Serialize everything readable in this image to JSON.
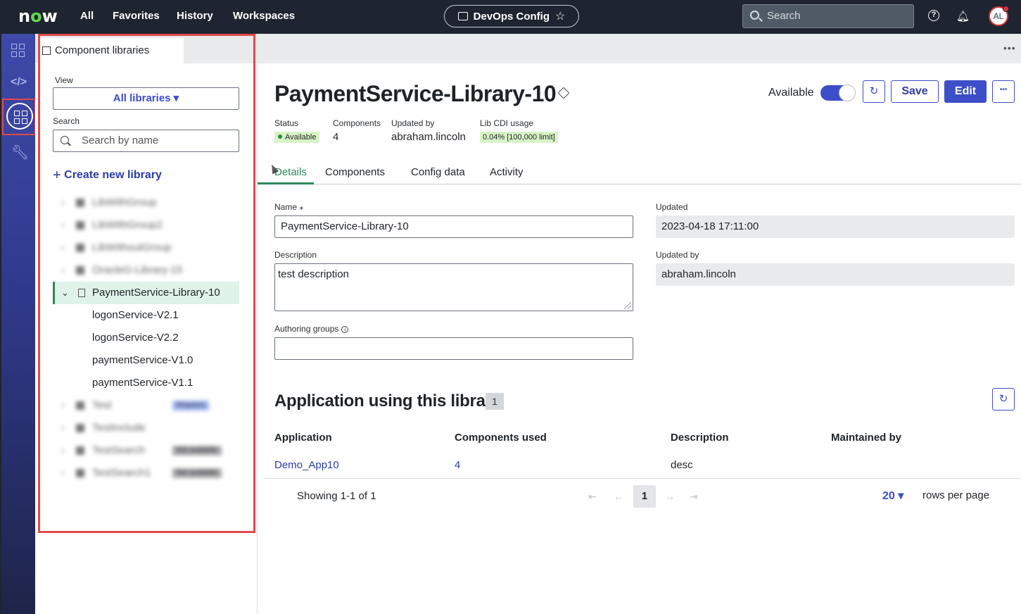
{
  "topbar": {
    "logo": "now",
    "nav": [
      "All",
      "Favorites",
      "History",
      "Workspaces"
    ],
    "workspace_pill": "DevOps Config",
    "search_placeholder": "Search",
    "avatar_initials": "AL"
  },
  "rail": {
    "icons": [
      "apps-grid-icon",
      "code-icon",
      "component-libraries-icon",
      "wrench-icon"
    ],
    "active": "component-libraries-icon"
  },
  "left_panel": {
    "tab_label": "Component libraries",
    "view_label": "View",
    "view_value": "All libraries",
    "search_label": "Search",
    "search_placeholder": "Search by name",
    "create_label": "Create new library",
    "tree_blurred": [
      {
        "label": "LibWithGroup"
      },
      {
        "label": "LibWithGroup2"
      },
      {
        "label": "LibWithoutGroup"
      },
      {
        "label": "OracleG-Library-15"
      }
    ],
    "selected": "PaymentService-Library-10",
    "children": [
      "logonService-V2.1",
      "logonService-V2.2",
      "paymentService-V1.0",
      "paymentService-V1.1"
    ],
    "tree_blurred_after": [
      {
        "label": "Test",
        "badge": "Requires"
      },
      {
        "label": "TestInclude",
        "badge": ""
      },
      {
        "label": "TestSearch",
        "badge": "Not available"
      },
      {
        "label": "TestSearch1",
        "badge": "Not available"
      }
    ]
  },
  "record": {
    "title": "PaymentService-Library-10",
    "status_label": "Status",
    "status_value": "Available",
    "components_label": "Components",
    "components_value": "4",
    "updated_by_label": "Updated by",
    "updated_by_value": "abraham.lincoln",
    "usage_label": "Lib CDI usage",
    "usage_value": "0.04% [100,000 limit]",
    "available_label": "Available",
    "available_on": true,
    "save_label": "Save",
    "edit_label": "Edit"
  },
  "tabs": [
    "Details",
    "Components",
    "Config data",
    "Activity"
  ],
  "active_tab": "Details",
  "form": {
    "name_label": "Name",
    "name_value": "PaymentService-Library-10",
    "description_label": "Description",
    "description_value": "test description",
    "authoring_label": "Authoring groups",
    "authoring_value": "",
    "updated_label": "Updated",
    "updated_value": "2023-04-18 17:11:00",
    "updatedby_label": "Updated by",
    "updatedby_value": "abraham.lincoln"
  },
  "apps": {
    "title": "Application using this library",
    "count": "1",
    "columns": [
      "Application",
      "Components used",
      "Description",
      "Maintained by"
    ],
    "rows": [
      {
        "application": "Demo_App10",
        "components_used": "4",
        "description": "desc",
        "maintained_by": ""
      }
    ],
    "showing": "Showing 1-1 of 1",
    "page": "1",
    "rows_per_page_value": "20",
    "rows_per_page_label": "rows per page"
  },
  "colors": {
    "accent": "#3c4ec8",
    "topbar": "#1e2530",
    "success": "#2d8a5c",
    "highlight_border": "#e04a4a"
  }
}
